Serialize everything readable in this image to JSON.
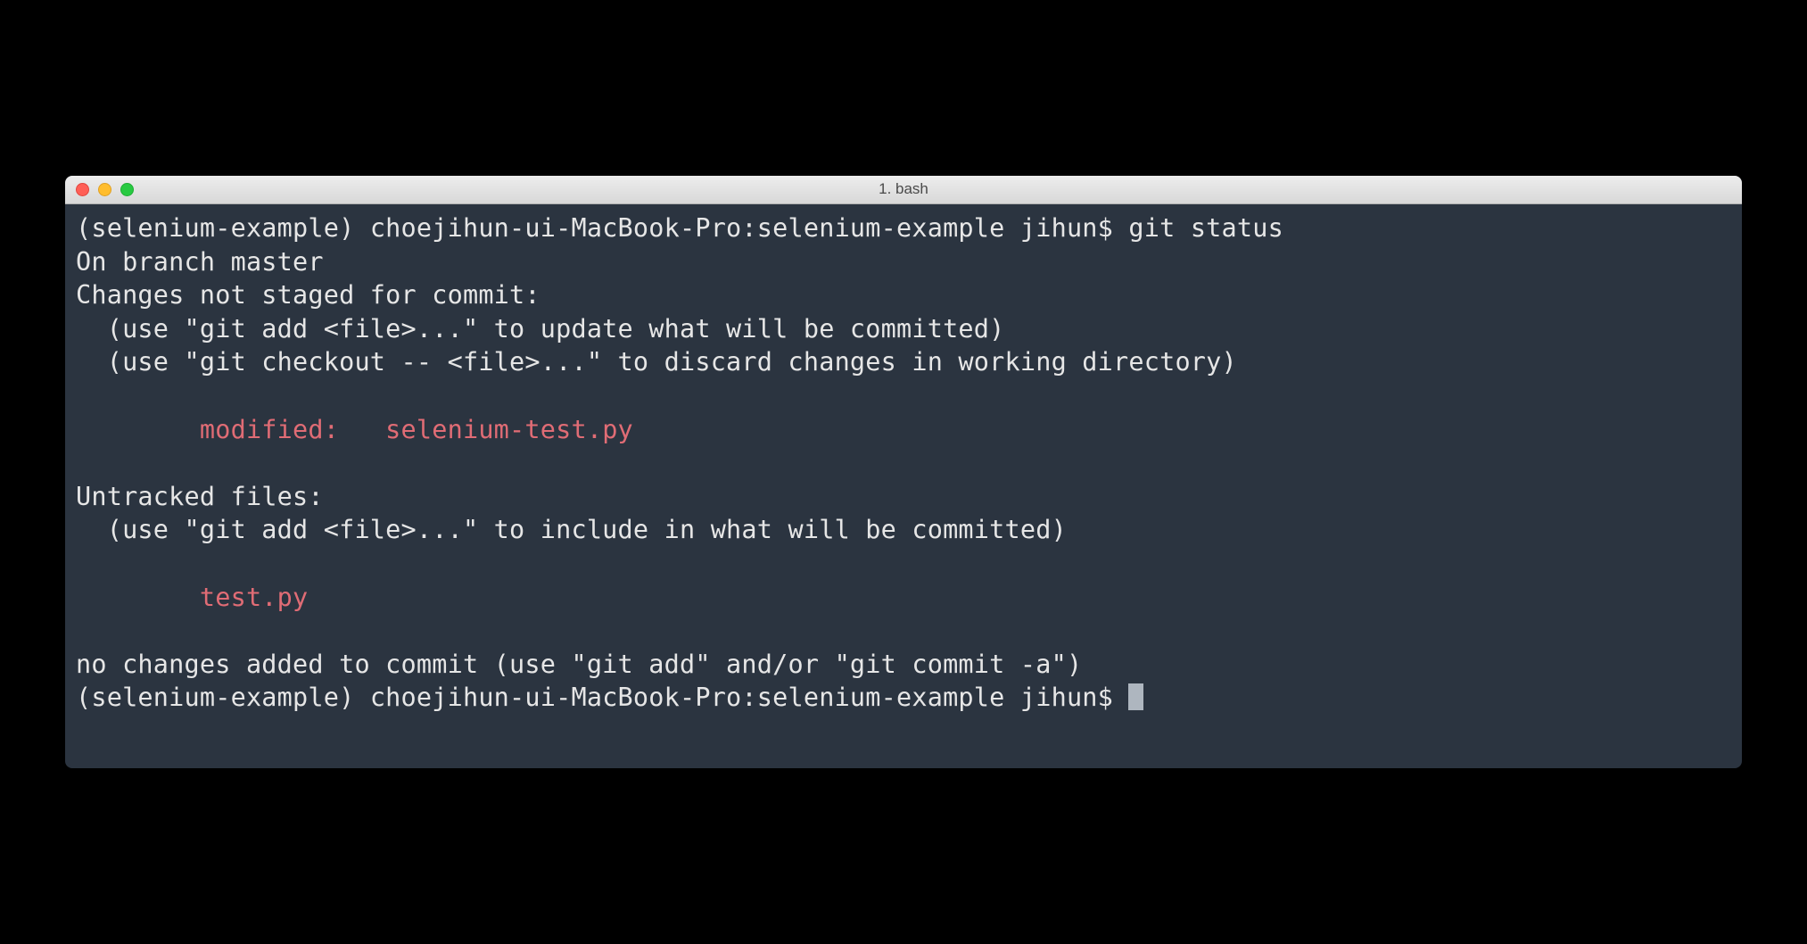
{
  "window": {
    "title": "1. bash"
  },
  "terminal": {
    "prompt1_env": "(selenium-example) ",
    "prompt1_host": "choejihun-ui-MacBook-Pro:selenium-example jihun$ ",
    "command1": "git status",
    "output": {
      "branch": "On branch master",
      "changes_header": "Changes not staged for commit:",
      "hint_add": "  (use \"git add <file>...\" to update what will be committed)",
      "hint_checkout": "  (use \"git checkout -- <file>...\" to discard changes in working directory)",
      "modified_indent": "        ",
      "modified_line": "modified:   selenium-test.py",
      "untracked_header": "Untracked files:",
      "hint_untracked": "  (use \"git add <file>...\" to include in what will be committed)",
      "untracked_indent": "        ",
      "untracked_file": "test.py",
      "no_changes": "no changes added to commit (use \"git add\" and/or \"git commit -a\")"
    },
    "prompt2_env": "(selenium-example) ",
    "prompt2_host": "choejihun-ui-MacBook-Pro:selenium-example jihun$ "
  }
}
